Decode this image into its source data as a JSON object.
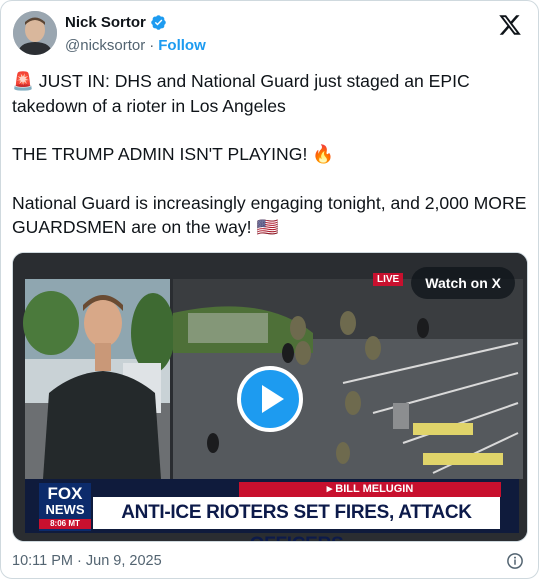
{
  "author": {
    "display_name": "Nick Sortor",
    "handle": "@nicksortor",
    "separator": "·",
    "follow_label": "Follow",
    "verified_icon": "verified-badge-icon"
  },
  "platform_icon": "x-logo-icon",
  "tweet": {
    "line1": "🚨 JUST IN: DHS and National Guard just staged an EPIC takedown of a rioter in Los Angeles",
    "line2": "THE TRUMP ADMIN ISN'T PLAYING! 🔥",
    "line3": "National Guard is increasingly engaging tonight, and 2,000 MORE GUARDSMEN are on the way! 🇺🇸"
  },
  "media": {
    "watch_label": "Watch on X",
    "live_label": "LIVE",
    "chyron_reporter": "▸ BILL MELUGIN",
    "chyron_headline": "ANTI-ICE RIOTERS SET FIRES, ATTACK OFFICERS",
    "network_line1": "FOX",
    "network_line2": "NEWS",
    "network_time": "8:06 MT",
    "play_icon": "play-icon"
  },
  "footer": {
    "timestamp": "10:11 PM · Jun 9, 2025",
    "info_icon": "info-icon"
  },
  "colors": {
    "accent": "#1d9bf0",
    "text": "#0f1419",
    "muted": "#536471",
    "fox_red": "#c8102e",
    "fox_blue": "#0c2b6b"
  }
}
